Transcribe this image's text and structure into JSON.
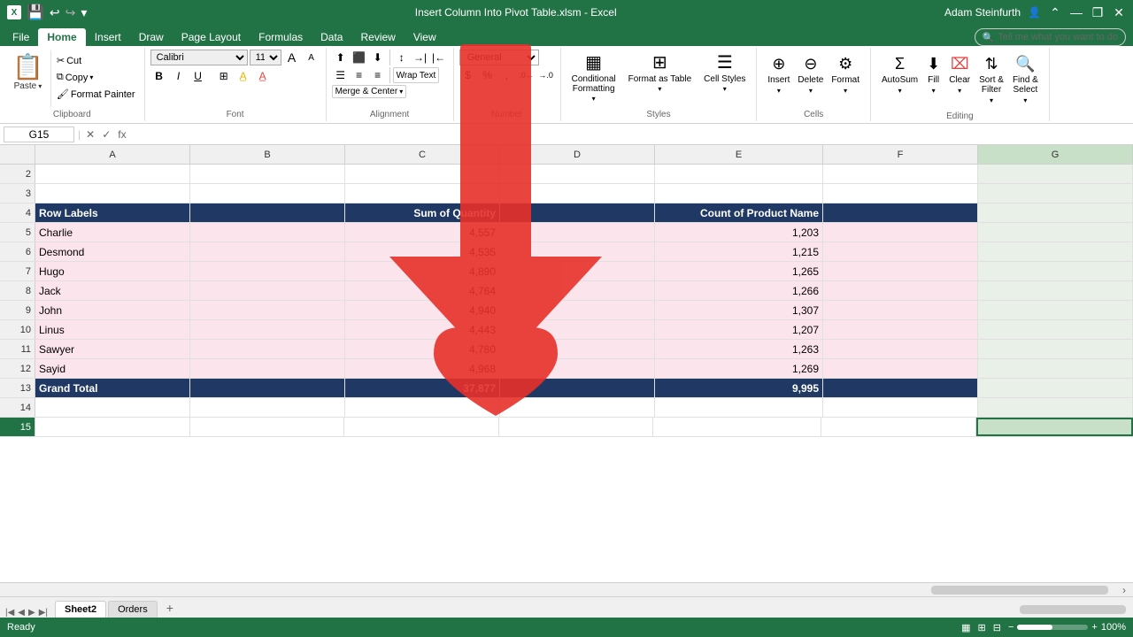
{
  "titleBar": {
    "title": "Insert Column Into Pivot Table.xlsm - Excel",
    "appName": "X",
    "userName": "Adam Steinfurth"
  },
  "ribbonTabs": [
    "File",
    "Home",
    "Insert",
    "Draw",
    "Page Layout",
    "Formulas",
    "Data",
    "Review",
    "View"
  ],
  "activeTab": "Home",
  "tellMe": "Tell me what you want to do",
  "clipboard": {
    "label": "Clipboard",
    "paste": "Paste",
    "cut": "Cut",
    "copy": "Copy",
    "formatPainter": "Format Painter"
  },
  "font": {
    "label": "Font",
    "name": "Calibri",
    "size": "11",
    "bold": "B",
    "italic": "I",
    "underline": "U",
    "border": "⊞",
    "fillColor": "A",
    "fontColor": "A"
  },
  "alignment": {
    "label": "Alignment",
    "wrapText": "Wrap Text",
    "mergeCenter": "Merge & Center"
  },
  "number": {
    "label": "Number",
    "format": "General",
    "percent": "%",
    "comma": ",",
    "decrease": ".0",
    "increase": ".00"
  },
  "styles": {
    "label": "Styles",
    "conditionalFormatting": "Conditional Formatting",
    "formatAsTable": "Format as Table",
    "cellStyles": "Cell Styles"
  },
  "cells": {
    "label": "Cells",
    "insert": "Insert",
    "delete": "Delete",
    "format": "Format"
  },
  "editing": {
    "label": "Editing",
    "autoSum": "AutoSum",
    "fill": "Fill",
    "clear": "Clear",
    "sortFilter": "Sort & Filter",
    "findSelect": "Find & Select"
  },
  "formulaBar": {
    "nameBox": "G15",
    "formula": ""
  },
  "columns": [
    "A",
    "B",
    "C",
    "D",
    "E",
    "F",
    "G"
  ],
  "selectedCol": "G",
  "rows": [
    {
      "num": 2,
      "cells": [
        "",
        "",
        "",
        "",
        "",
        "",
        ""
      ]
    },
    {
      "num": 3,
      "cells": [
        "",
        "",
        "",
        "",
        "",
        "",
        ""
      ]
    },
    {
      "num": 4,
      "isPivotHeader": true,
      "cells": [
        "Row Labels",
        "",
        "Sum of Quantity",
        "",
        "Count of Product Name",
        "",
        ""
      ]
    },
    {
      "num": 5,
      "isPivotData": true,
      "cells": [
        "Charlie",
        "",
        "4,557",
        "",
        "1,203",
        "",
        ""
      ]
    },
    {
      "num": 6,
      "isPivotData": true,
      "cells": [
        "Desmond",
        "",
        "4,535",
        "",
        "1,215",
        "",
        ""
      ]
    },
    {
      "num": 7,
      "isPivotData": true,
      "cells": [
        "Hugo",
        "",
        "4,890",
        "",
        "1,265",
        "",
        ""
      ]
    },
    {
      "num": 8,
      "isPivotData": true,
      "cells": [
        "Jack",
        "",
        "4,764",
        "",
        "1,266",
        "",
        ""
      ]
    },
    {
      "num": 9,
      "isPivotData": true,
      "cells": [
        "John",
        "",
        "4,940",
        "",
        "1,307",
        "",
        ""
      ]
    },
    {
      "num": 10,
      "isPivotData": true,
      "cells": [
        "Linus",
        "",
        "4,443",
        "",
        "1,207",
        "",
        ""
      ]
    },
    {
      "num": 11,
      "isPivotData": true,
      "cells": [
        "Sawyer",
        "",
        "4,780",
        "",
        "1,263",
        "",
        ""
      ]
    },
    {
      "num": 12,
      "isPivotData": true,
      "cells": [
        "Sayid",
        "",
        "4,968",
        "",
        "1,269",
        "",
        ""
      ]
    },
    {
      "num": 13,
      "isPivotTotal": true,
      "cells": [
        "Grand Total",
        "",
        "37,877",
        "",
        "9,995",
        "",
        ""
      ]
    },
    {
      "num": 14,
      "cells": [
        "",
        "",
        "",
        "",
        "",
        "",
        ""
      ]
    },
    {
      "num": 15,
      "cells": [
        "",
        "",
        "",
        "",
        "",
        "",
        ""
      ]
    }
  ],
  "sheets": [
    "Sheet2",
    "Orders"
  ],
  "activeSheet": "Sheet2",
  "statusBar": {
    "status": "Ready"
  },
  "clearMenuText": "Clear \""
}
